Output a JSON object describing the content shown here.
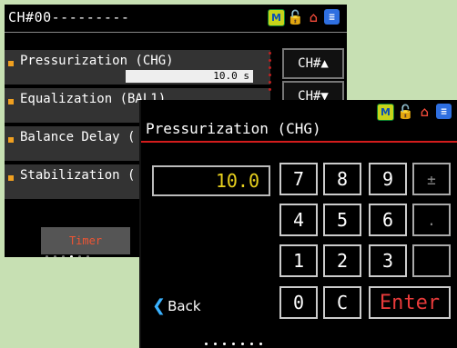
{
  "background_screen": {
    "header": {
      "title": "CH#00---------"
    },
    "items": [
      {
        "label": "Pressurization (CHG)",
        "value": "10.0 s"
      },
      {
        "label": "Equalization (BAL1)",
        "value": ""
      },
      {
        "label": "Balance Delay (",
        "value": ""
      },
      {
        "label": "Stabilization (",
        "value": ""
      }
    ],
    "side_buttons": {
      "ch_up": "CH#▲",
      "ch_down": "CH#▼"
    },
    "bottom": {
      "timer_label": "Timer"
    }
  },
  "dialog": {
    "title": "Pressurization (CHG)",
    "value": "10.0",
    "keys": {
      "k7": "7",
      "k8": "8",
      "k9": "9",
      "pm": "±",
      "k4": "4",
      "k5": "5",
      "k6": "6",
      "dot": ".",
      "k1": "1",
      "k2": "2",
      "k3": "3",
      "k0": "0",
      "clear": "C",
      "enter": "Enter"
    },
    "back_label": "Back"
  },
  "icons": [
    "m-icon",
    "lock-icon",
    "home-icon",
    "document-icon"
  ],
  "colors": {
    "accent_red": "#d41c1c",
    "value_yellow": "#e8d11e",
    "background": "#c7e0b3"
  }
}
